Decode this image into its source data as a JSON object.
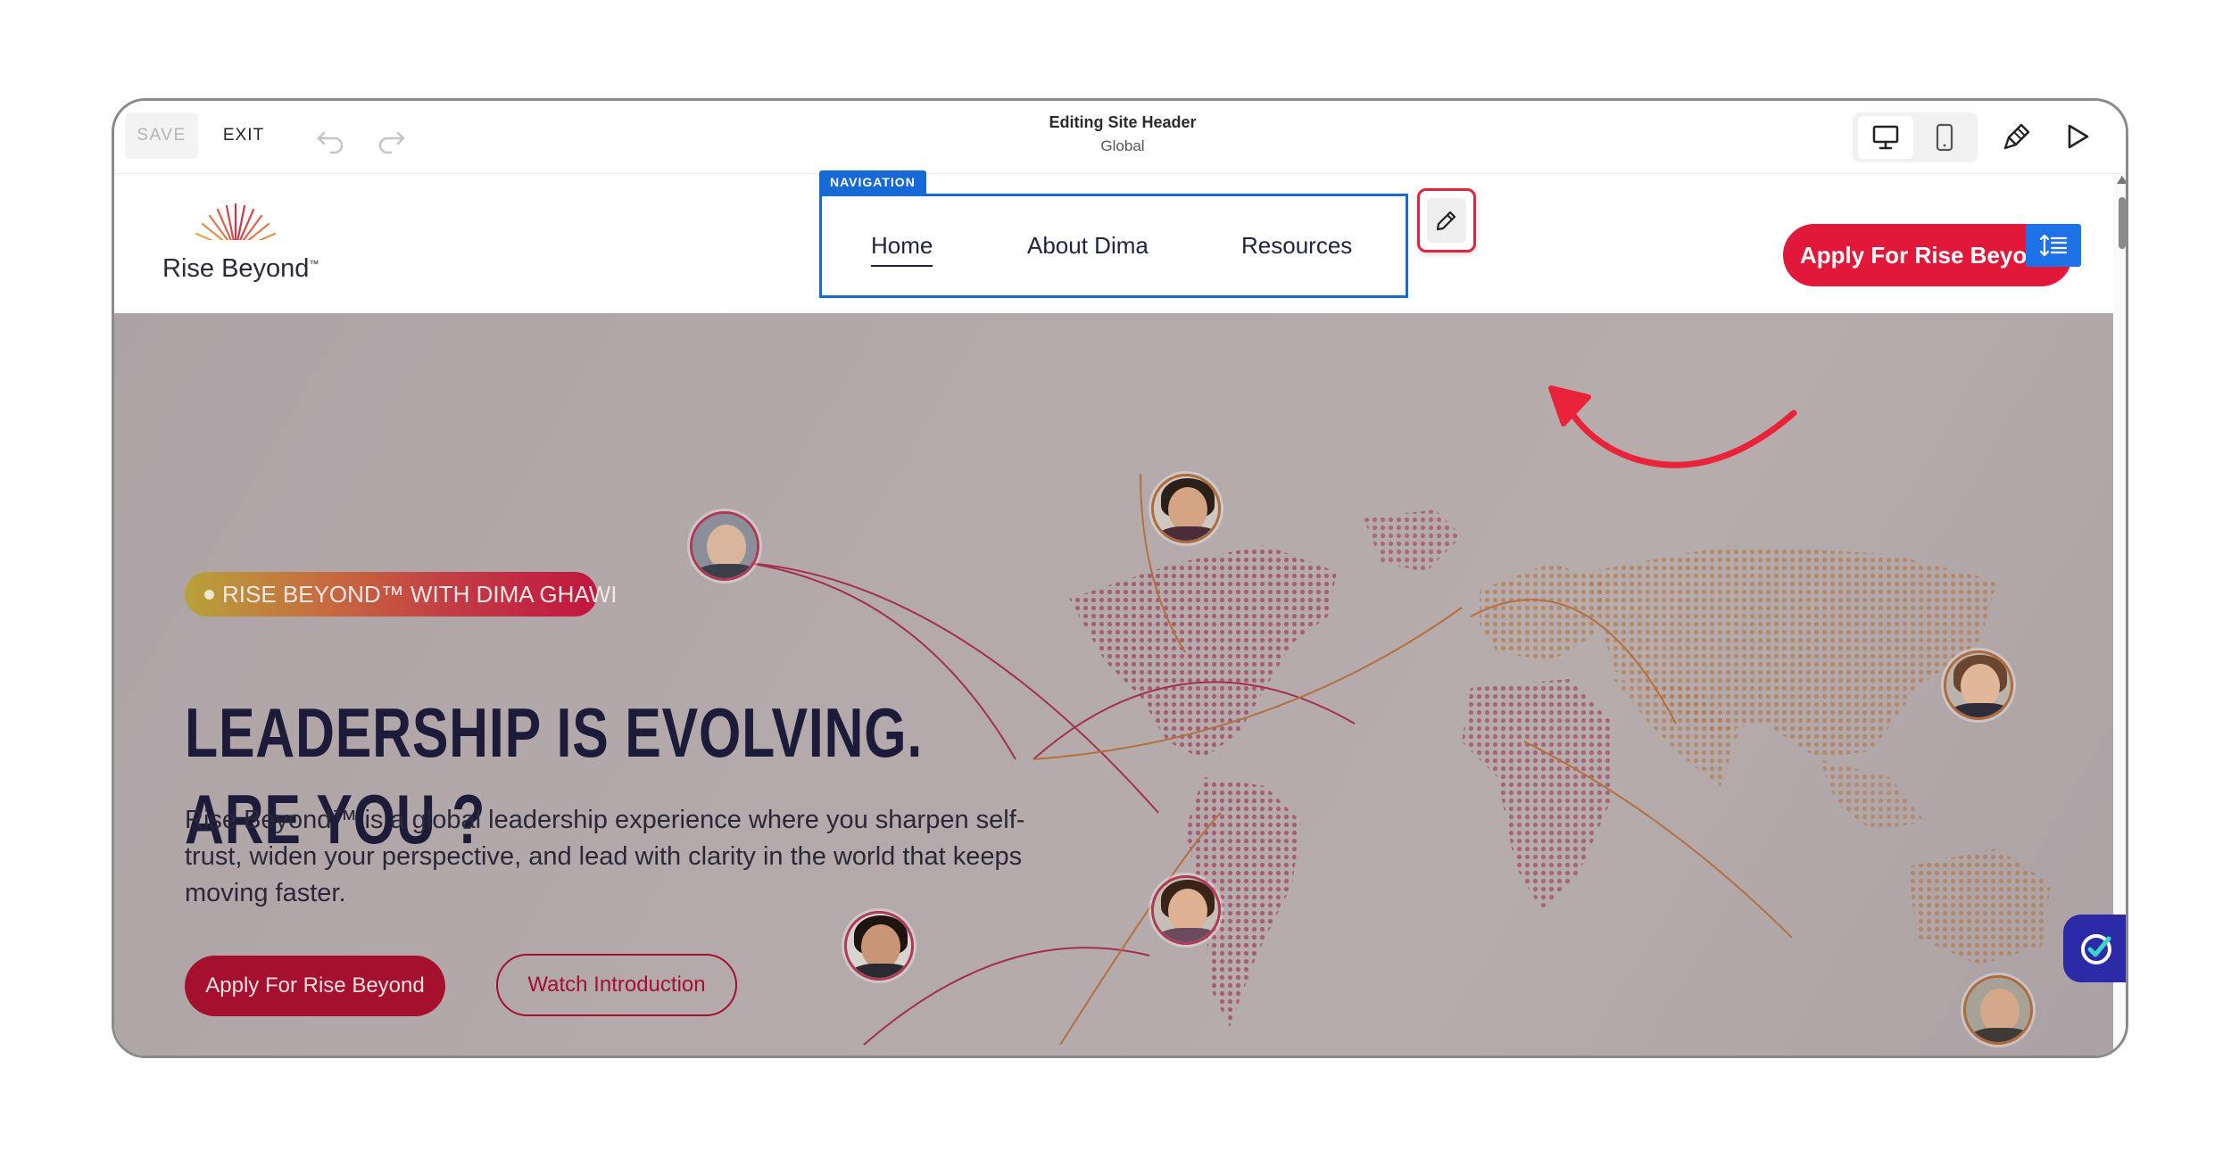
{
  "editor": {
    "save_label": "SAVE",
    "exit_label": "EXIT",
    "title": "Editing Site Header",
    "subtitle": "Global"
  },
  "header": {
    "logo_text": "Rise Beyond",
    "logo_tm": "™",
    "nav_tag": "NAVIGATION",
    "nav_links": [
      "Home",
      "About Dima",
      "Resources"
    ],
    "cta_label": "Apply For Rise Beyond"
  },
  "hero": {
    "tagline": "RISE BEYOND™ WITH DIMA GHAWI",
    "title_line1": "LEADERSHIP IS EVOLVING.",
    "title_line2": "ARE YOU ?",
    "description": "Rise Beyond™ is a global leadership experience where you sharpen self-trust, widen your  perspective, and lead with clarity in the world that keeps moving faster.",
    "primary_button": "Apply For Rise Beyond",
    "secondary_button": "Watch Introduction"
  },
  "colors": {
    "accent_blue": "#1769d6",
    "brand_red": "#e2183a",
    "hero_button_red": "#a4102d",
    "title_navy": "#1c1c3a"
  },
  "icons": [
    "undo-icon",
    "redo-icon",
    "desktop-icon",
    "mobile-icon",
    "brush-icon",
    "play-icon",
    "pencil-icon",
    "spacing-icon",
    "chat-widget-icon"
  ]
}
